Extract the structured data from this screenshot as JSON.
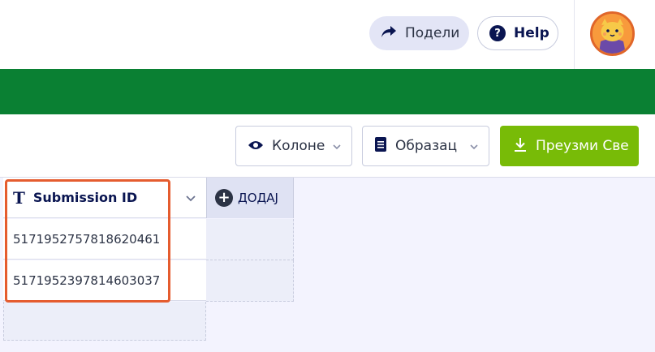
{
  "header": {
    "share_label": "Подели",
    "help_label": "Help",
    "help_icon_glyph": "?"
  },
  "toolbar": {
    "columns_label": "Колоне",
    "form_label": "Образац",
    "download_all_label": "Преузми Све"
  },
  "table": {
    "column_header": "Submission ID",
    "column_type_glyph": "T",
    "add_column_label": "ДОДАЈ",
    "rows": [
      {
        "submission_id": "5171952757818620461"
      },
      {
        "submission_id": "5171952397814603037"
      }
    ]
  },
  "colors": {
    "green_bar": "#0a8033",
    "download_button": "#78bb07",
    "highlight_border": "#e55c2f",
    "navy": "#0a1551"
  }
}
